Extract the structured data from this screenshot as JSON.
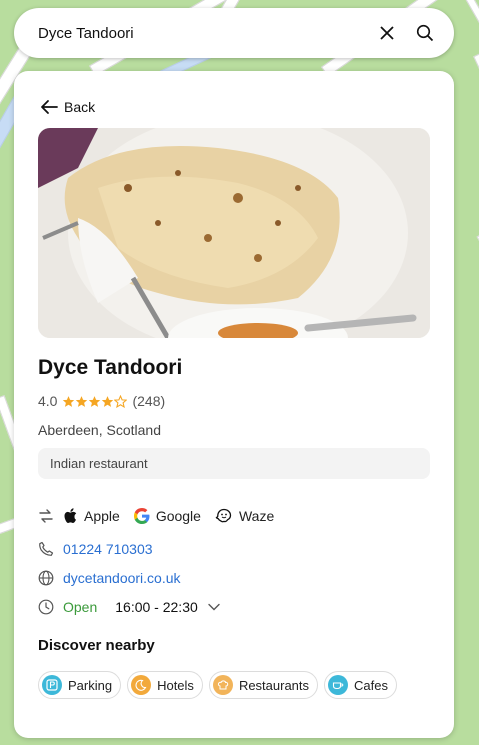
{
  "search": {
    "value": "Dyce Tandoori",
    "clear_icon": "close-icon",
    "search_icon": "search-icon"
  },
  "panel": {
    "back_label": "Back",
    "photo_alt": "Naan bread",
    "name": "Dyce Tandoori",
    "rating_value": "4.0",
    "rating_stars": 4,
    "review_count": "(248)",
    "location": "Aberdeen, Scotland",
    "category": "Indian restaurant",
    "navigation": {
      "apple": "Apple",
      "google": "Google",
      "waze": "Waze"
    },
    "phone": "01224 710303",
    "website": "dycetandoori.co.uk",
    "open_status": "Open",
    "hours": "16:00 - 22:30",
    "discover_title": "Discover nearby",
    "nearby": [
      {
        "label": "Parking",
        "color": "#3db8d9"
      },
      {
        "label": "Hotels",
        "color": "#f2a93b"
      },
      {
        "label": "Restaurants",
        "color": "#f2b45a"
      },
      {
        "label": "Cafes",
        "color": "#3db8d9"
      }
    ]
  },
  "colors": {
    "accent_link": "#2a6fd1",
    "open_green": "#3b9a3b",
    "star": "#f5a623",
    "map": "#b8dd9e"
  }
}
